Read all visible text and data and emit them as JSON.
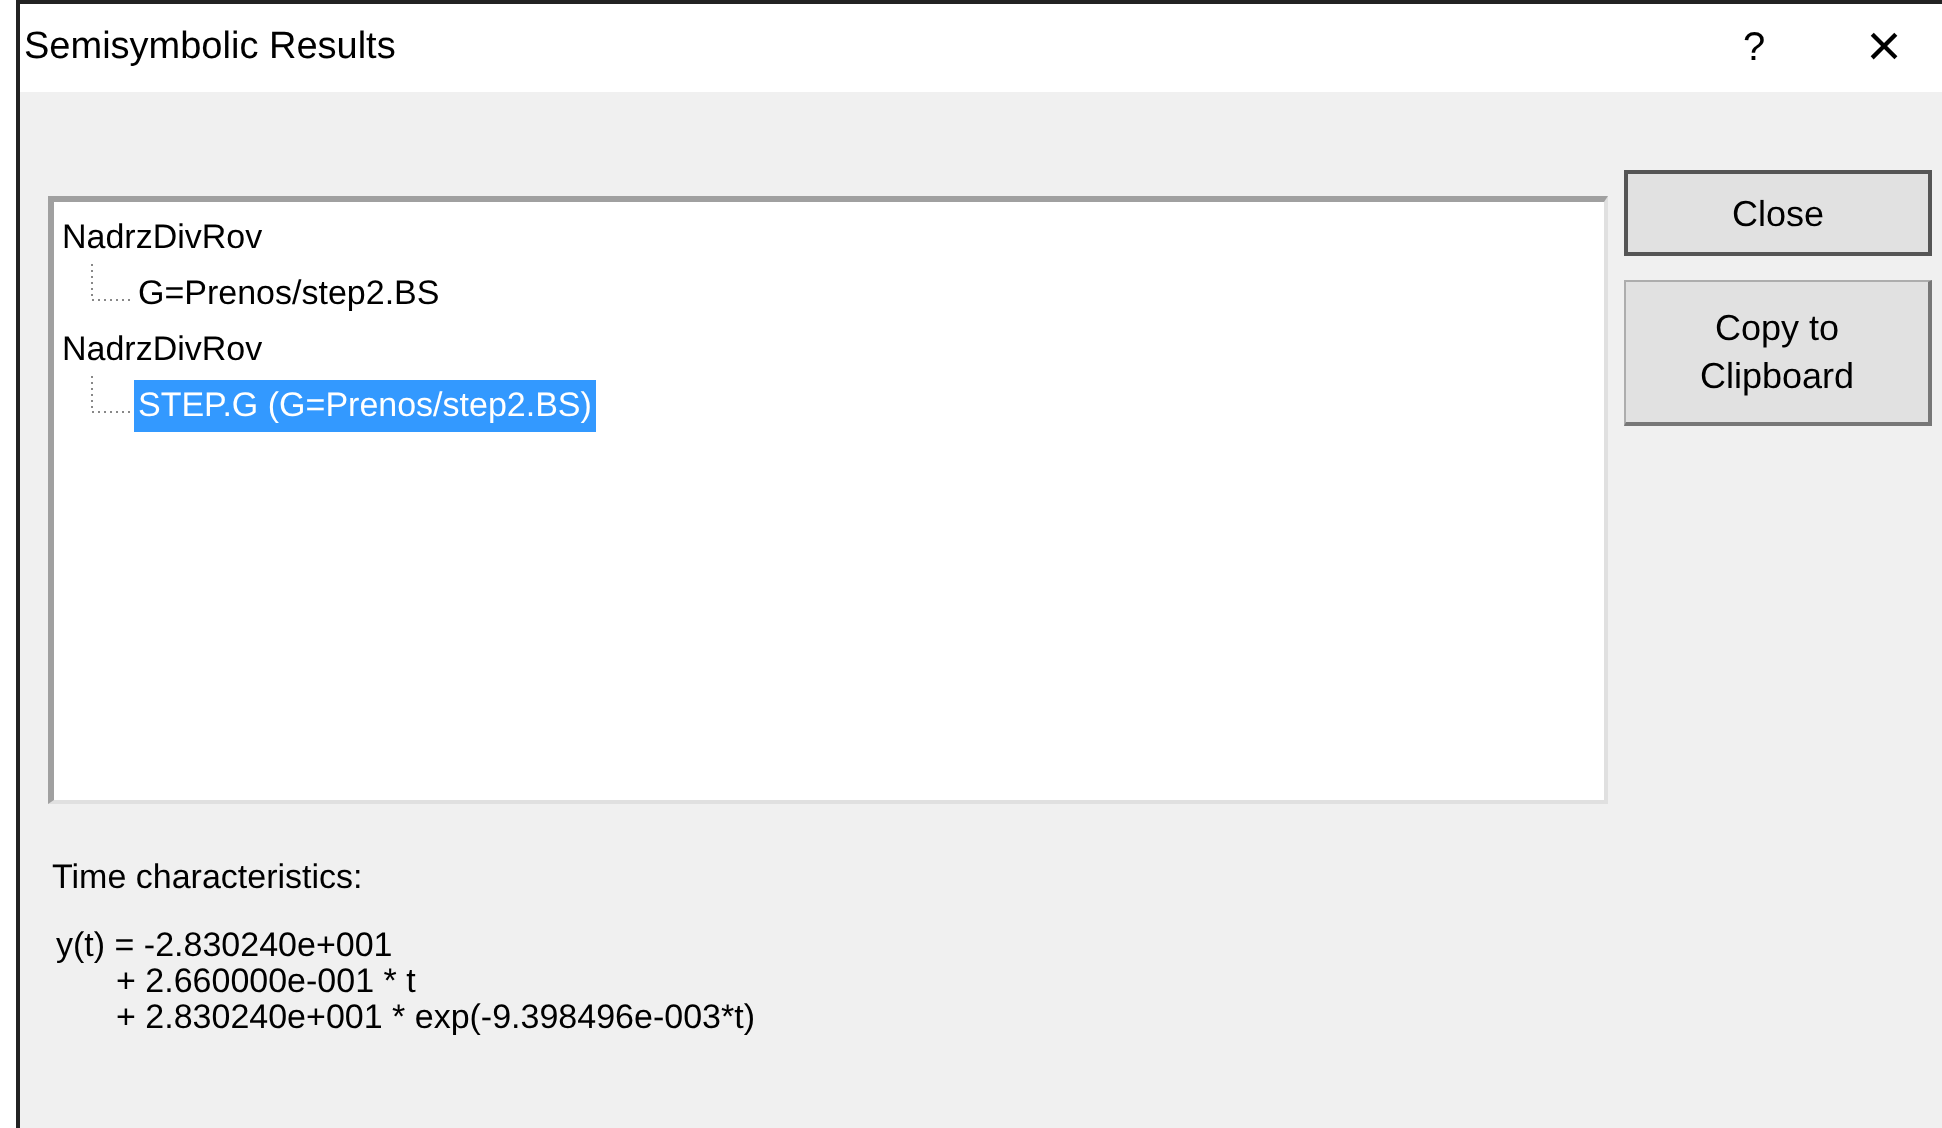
{
  "window": {
    "title": "Semisymbolic Results",
    "help_glyph": "?",
    "close_glyph": "×"
  },
  "tree": [
    {
      "label": "NadrzDivRov",
      "selected": false,
      "children": [
        {
          "label": "G=Prenos/step2.BS",
          "selected": false
        }
      ]
    },
    {
      "label": "NadrzDivRov",
      "selected": false,
      "children": [
        {
          "label": "STEP.G (G=Prenos/step2.BS)",
          "selected": true
        }
      ]
    }
  ],
  "buttons": [
    {
      "label": "Close",
      "default": true
    },
    {
      "label": "Copy to\nClipboard",
      "default": false
    }
  ],
  "time_characteristics": {
    "label": "Time characteristics:",
    "lines": [
      "y(t) = -2.830240e+001",
      "+ 2.660000e-001 * t",
      "+ 2.830240e+001 * exp(-9.398496e-003*t)"
    ]
  }
}
